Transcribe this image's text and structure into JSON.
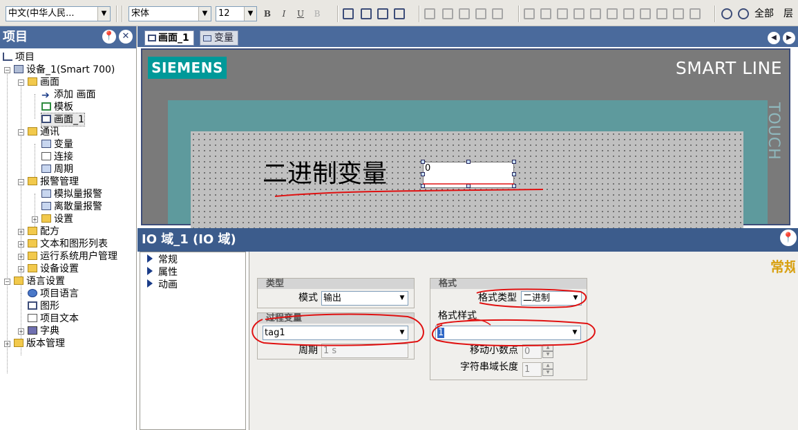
{
  "toolbar": {
    "language_combo": "中文(中华人民...",
    "font_combo": "宋体",
    "size_combo": "12",
    "bold": "B",
    "italic": "I",
    "underline": "U",
    "strike": "B",
    "all_label": "全部",
    "layer_label": "层"
  },
  "project_tree": {
    "title": "项目",
    "items": [
      {
        "label": "项目"
      },
      {
        "label": "设备_1(Smart 700)"
      },
      {
        "label": "画面"
      },
      {
        "label": "添加 画面"
      },
      {
        "label": "模板"
      },
      {
        "label": "画面_1"
      },
      {
        "label": "通讯"
      },
      {
        "label": "变量"
      },
      {
        "label": "连接"
      },
      {
        "label": "周期"
      },
      {
        "label": "报警管理"
      },
      {
        "label": "模拟量报警"
      },
      {
        "label": "离散量报警"
      },
      {
        "label": "设置"
      },
      {
        "label": "配方"
      },
      {
        "label": "文本和图形列表"
      },
      {
        "label": "运行系统用户管理"
      },
      {
        "label": "设备设置"
      },
      {
        "label": "语言设置"
      },
      {
        "label": "项目语言"
      },
      {
        "label": "图形"
      },
      {
        "label": "项目文本"
      },
      {
        "label": "字典"
      },
      {
        "label": "版本管理"
      }
    ]
  },
  "editor_tabs": [
    {
      "label": "画面_1"
    },
    {
      "label": "变量"
    }
  ],
  "hmi": {
    "brand": "SIEMENS",
    "series": "SMART LINE",
    "touch": "TOUCH",
    "screen_text": "二进制变量",
    "io_value": "0"
  },
  "properties": {
    "title": "IO 域_1 (IO 域)",
    "category": "常规",
    "nav": [
      {
        "label": "常规"
      },
      {
        "label": "属性"
      },
      {
        "label": "动画"
      }
    ],
    "type_group": {
      "title": "类型",
      "mode_label": "模式",
      "mode_value": "输出"
    },
    "process_group": {
      "title": "过程变量",
      "tag_value": "tag1",
      "cycle_label": "周期",
      "cycle_value": "1 s"
    },
    "format_group": {
      "title": "格式",
      "format_type_label": "格式类型",
      "format_type_value": "二进制",
      "format_style_label": "格式样式",
      "format_style_value": "1",
      "decimal_label": "移动小数点",
      "decimal_value": "0",
      "length_label": "字符串域长度",
      "length_value": "1"
    }
  },
  "colors": {
    "header_blue": "#4a6a9c",
    "siemens_teal": "#009999",
    "annotation_red": "#e01010"
  }
}
